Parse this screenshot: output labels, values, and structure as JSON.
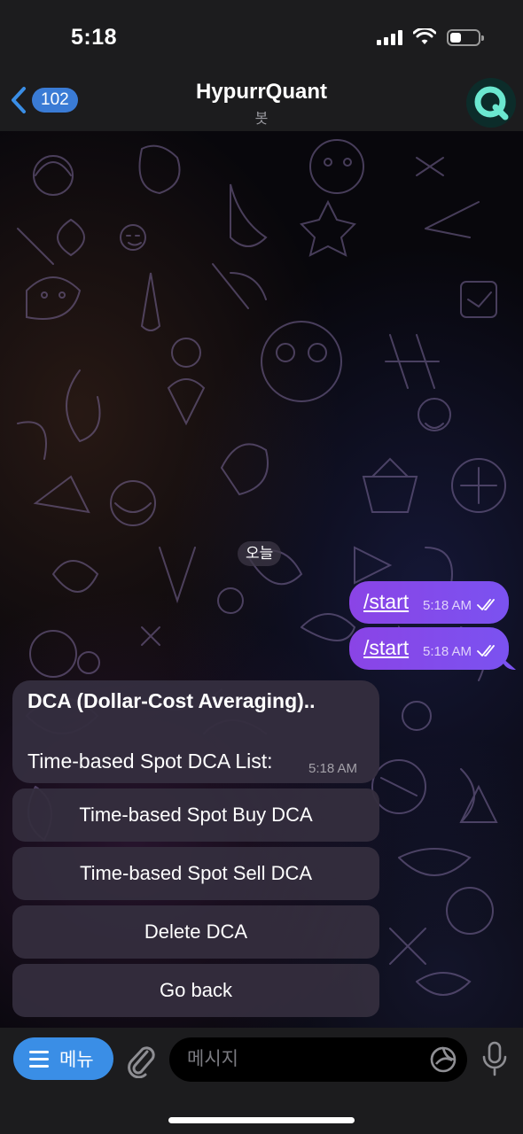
{
  "status_bar": {
    "time": "5:18",
    "battery_level": 0.4
  },
  "header": {
    "back_count": "102",
    "title": "HypurrQuant",
    "subtitle": "봇",
    "avatar_letter": "Q",
    "avatar_color": "#6be8d0"
  },
  "chat": {
    "date_label": "오늘",
    "outgoing": [
      {
        "text": "/start",
        "time": "5:18 AM"
      },
      {
        "text": "/start",
        "time": "5:18 AM"
      }
    ],
    "bot_message": {
      "title": "DCA (Dollar-Cost Averaging)..",
      "body": "Time-based Spot DCA List:",
      "time": "5:18 AM"
    },
    "keyboard": [
      {
        "label": "Time-based Spot Buy DCA"
      },
      {
        "label": "Time-based Spot Sell DCA"
      },
      {
        "label": "Delete DCA"
      },
      {
        "label": "Go back"
      }
    ]
  },
  "input_bar": {
    "menu_label": "메뉴",
    "placeholder": "메시지"
  },
  "colors": {
    "accent": "#3a8ee6",
    "outgoing_bubble": "#8a44e6",
    "bot_bubble": "#342e3e"
  }
}
